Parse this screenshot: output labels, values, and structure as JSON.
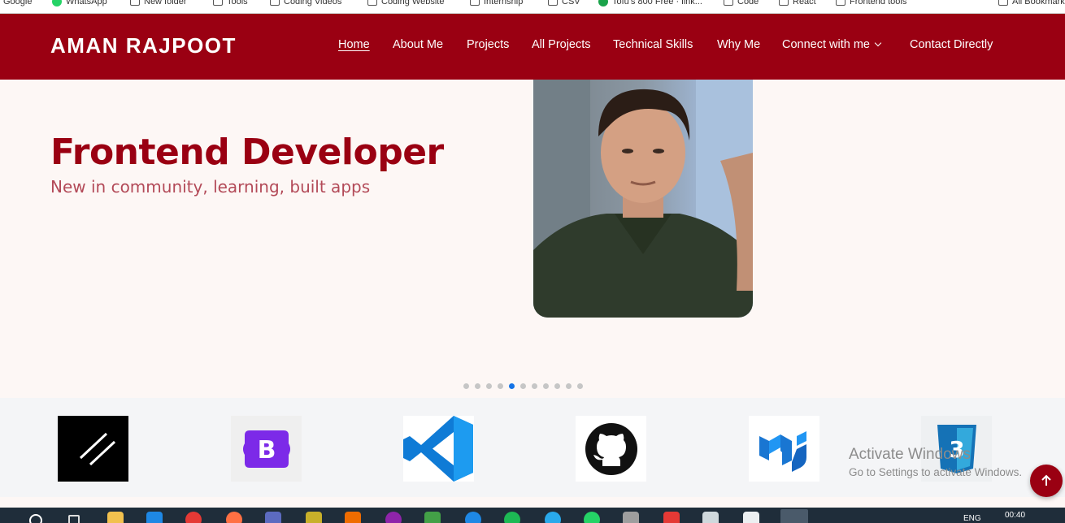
{
  "bookmarks": [
    "Google",
    "WhatsApp",
    "New folder",
    "Tools",
    "Coding Videos",
    "Coding Website",
    "Internship",
    "CSV",
    "Tofu's 800 Free · link...",
    "Code",
    "React",
    "Frontend tools",
    "All Bookmarks"
  ],
  "navbar": {
    "brand": "AMAN RAJPOOT",
    "links": [
      "Home",
      "About Me",
      "Projects",
      "All Projects",
      "Technical Skills",
      "Why Me",
      "Connect with me",
      "Contact Directly"
    ]
  },
  "hero": {
    "title": "Frontend Developer",
    "subtitle": "New in community, learning, built apps",
    "carousel_dots": 11,
    "active_dot": 4
  },
  "logos": [
    "next-js-logo",
    "bootstrap-logo",
    "vscode-logo",
    "github-logo",
    "material-ui-logo",
    "css3-logo"
  ],
  "watermark": {
    "line1": "Activate Windows",
    "line2": "Go to Settings to activate Windows."
  },
  "taskbar": {
    "lang": "ENG",
    "time": "00:40"
  },
  "colors": {
    "brand": "#9a0012",
    "accent_dot": "#1473e6"
  }
}
